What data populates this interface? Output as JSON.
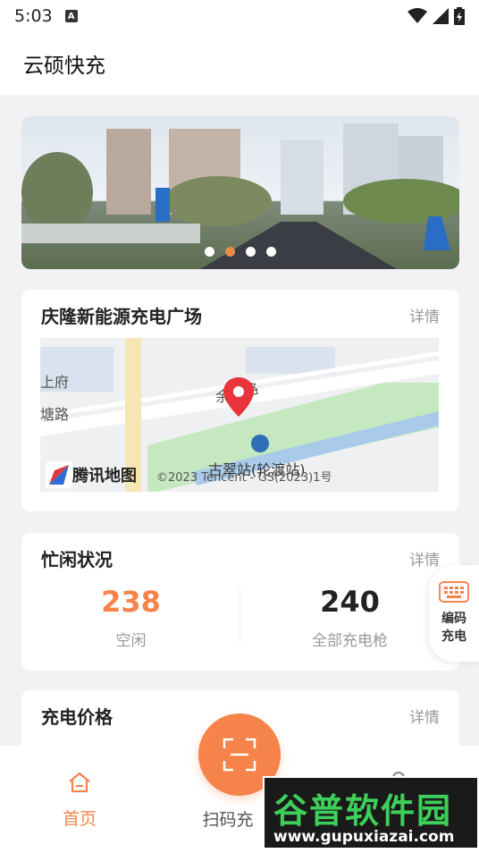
{
  "status": {
    "time": "5:03",
    "badge": "A"
  },
  "header": {
    "title": "云硕快充"
  },
  "station": {
    "title": "庆隆新能源充电广场",
    "detail_label": "详情"
  },
  "map": {
    "roads": [
      "上府",
      "余",
      "塘路",
      "塘路"
    ],
    "poi": "古翠站(轮渡站)",
    "logo_text": "腾讯地图",
    "copyright": "©2023 Tencent - GS(2023)1号"
  },
  "status_card": {
    "title": "忙闲状况",
    "detail_label": "详情",
    "idle_count": "238",
    "idle_label": "空闲",
    "total_count": "240",
    "total_label": "全部充电枪"
  },
  "price_card": {
    "title": "充电价格",
    "detail_label": "详情"
  },
  "float_button": {
    "label": "编码充电"
  },
  "nav": {
    "home": "首页",
    "scan": "扫码充"
  },
  "watermark": {
    "title": "谷普软件园",
    "url": "www.gupuxiazai.com"
  },
  "colors": {
    "accent": "#f5834a",
    "muted": "#999999"
  }
}
